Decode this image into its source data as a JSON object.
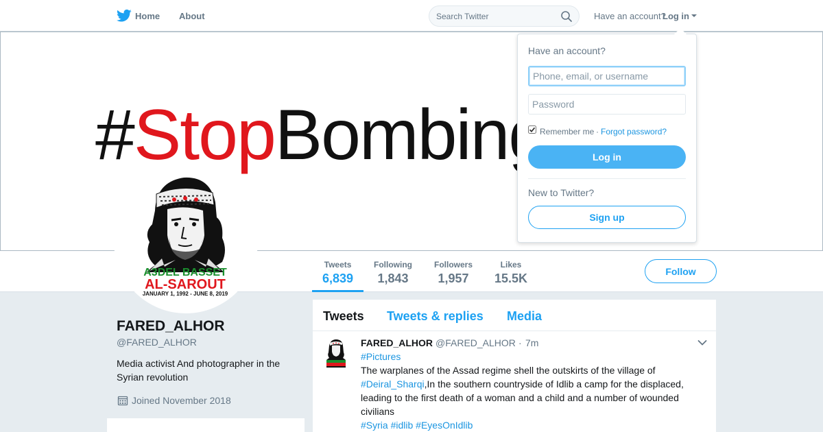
{
  "nav": {
    "home_label": "Home",
    "about_label": "About",
    "search_placeholder": "Search Twitter",
    "have_account": "Have an account?",
    "login_label": "Log in",
    "brand_color": "#1da1f2"
  },
  "banner": {
    "hash": "#",
    "red_word": "Stop",
    "black_word": "BombingIdlib",
    "red_color": "#e0171d"
  },
  "avatar": {
    "line1": "A3DEL BASSET",
    "line2": "AL-SAROUT",
    "line3": "JANUARY 1, 1992 - JUNE 8, 2019"
  },
  "stats": [
    {
      "label": "Tweets",
      "value": "6,839",
      "active": true
    },
    {
      "label": "Following",
      "value": "1,843"
    },
    {
      "label": "Followers",
      "value": "1,957"
    },
    {
      "label": "Likes",
      "value": "15.5K"
    }
  ],
  "follow_label": "Follow",
  "profile": {
    "name": "FARED_ALHOR",
    "handle": "@FARED_ALHOR",
    "bio": "Media activist And photographer in the Syrian revolution",
    "joined": "Joined November 2018"
  },
  "timeline": {
    "tabs": [
      "Tweets",
      "Tweets & replies",
      "Media"
    ],
    "tweet": {
      "name": "FARED_ALHOR",
      "handle": "@FARED_ALHOR",
      "separator": "·",
      "time": "7m",
      "tag_pictures": "#Pictures",
      "text1": " The warplanes of the Assad regime shell the outskirts of the village of ",
      "tag_deiral": "#Deiral_Sharqi",
      "text2": ",In the southern countryside of Idlib a camp for the displaced, leading to the first death of a woman and a child and a number of wounded civilians",
      "tag_syria": "#Syria",
      "tag_idlib": "#idlib",
      "tag_eyes": "#EyesOnIdlib"
    }
  },
  "login_dropdown": {
    "title": "Have an account?",
    "username_placeholder": "Phone, email, or username",
    "password_placeholder": "Password",
    "remember_label": "Remember me",
    "dot": "·",
    "forgot_label": "Forgot password?",
    "login_button": "Log in",
    "new_prompt": "New to Twitter?",
    "signup_button": "Sign up"
  }
}
